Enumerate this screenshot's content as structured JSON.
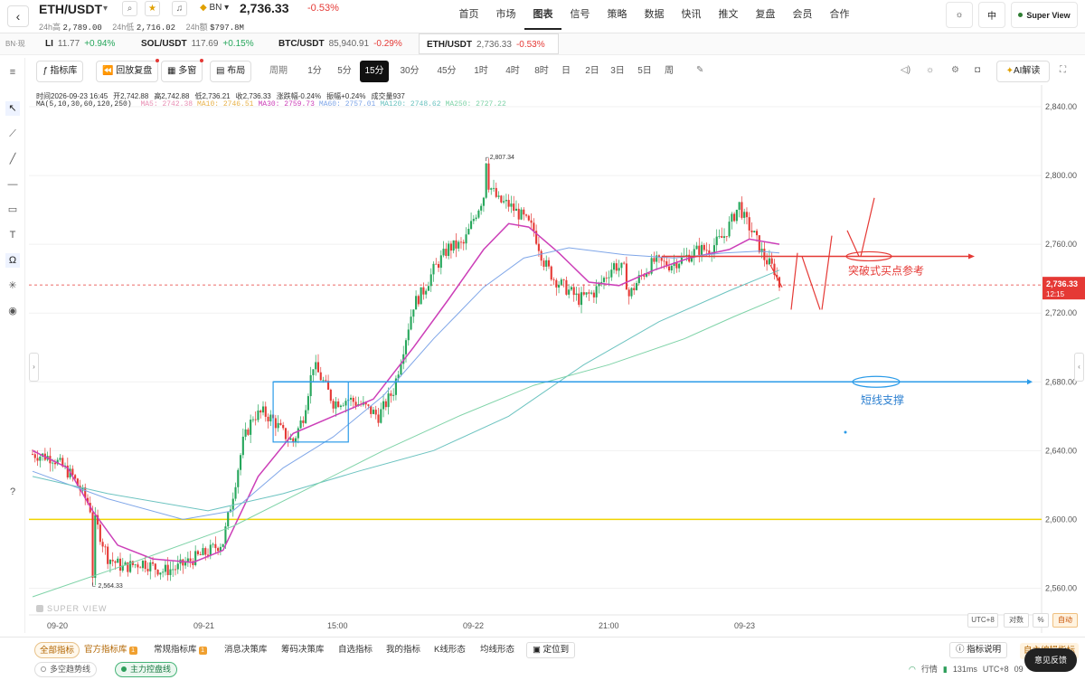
{
  "header": {
    "symbol": "ETH/USDT",
    "exchange": "BN",
    "price": "2,736.33",
    "change_pct": "-0.53%",
    "stats": [
      {
        "label": "24h高",
        "value": "2,789.00"
      },
      {
        "label": "24h低",
        "value": "2,716.02"
      },
      {
        "label": "24h额",
        "value": "$797.8M"
      }
    ],
    "nav": [
      "首页",
      "市场",
      "图表",
      "信号",
      "策略",
      "数据",
      "快讯",
      "推文",
      "复盘",
      "会员",
      "合作"
    ],
    "nav_active": "图表",
    "lang": "中",
    "super_view": "Super View"
  },
  "tickers": {
    "exchange_label": "BN·现",
    "items": [
      {
        "name": "LI",
        "price": "11.77",
        "change": "+0.94%",
        "dir": "up"
      },
      {
        "name": "SOL/USDT",
        "price": "117.69",
        "change": "+0.15%",
        "dir": "up"
      },
      {
        "name": "BTC/USDT",
        "price": "85,940.91",
        "change": "-0.29%",
        "dir": "down"
      },
      {
        "name": "ETH/USDT",
        "price": "2,736.33",
        "change": "-0.53%",
        "dir": "down"
      }
    ]
  },
  "toolbar": {
    "indicator_lib": "指标库",
    "replay": "回放复盘",
    "multi_window": "多窗",
    "layout": "布局",
    "period_label": "周期",
    "periods": [
      "1分",
      "5分",
      "15分",
      "30分",
      "45分",
      "1时",
      "4时",
      "8时",
      "日",
      "2日",
      "3日",
      "5日",
      "周"
    ],
    "period_active": "15分",
    "ai_label": "AI解读"
  },
  "ohlc_info": {
    "time": "时间2026-09-23 16:45",
    "open": "开2,742.88",
    "high": "高2,742.88",
    "low": "低2,736.21",
    "close": "收2,736.33",
    "change": "涨跌幅-0.24%",
    "amplitude": "振幅+0.24%",
    "volume": "成交量937"
  },
  "ma_info": {
    "label": "MA(5,10,30,60,120,250)",
    "items": [
      {
        "text": "MA5: 2742.38",
        "color": "#e88fb4"
      },
      {
        "text": "MA10: 2746.51",
        "color": "#e8b24a"
      },
      {
        "text": "MA30: 2759.73",
        "color": "#cc3fb8"
      },
      {
        "text": "MA60: 2757.01",
        "color": "#7fa6e8"
      },
      {
        "text": "MA120: 2748.62",
        "color": "#6cc3c0"
      },
      {
        "text": "MA250: 2727.22",
        "color": "#7fd3a8"
      }
    ]
  },
  "chart_data": {
    "type": "candlestick",
    "title": "",
    "ylim": [
      2545,
      2850
    ],
    "y_ticks": [
      2560,
      2600,
      2640,
      2680,
      2720,
      2760,
      2800,
      2840
    ],
    "y_tick_labels": [
      "2,560.00",
      "2,600.00",
      "2,640.00",
      "2,680.00",
      "2,720.00",
      "2,760.00",
      "2,800.00",
      "2,840.00"
    ],
    "x_labels": [
      "09-20",
      "09-21",
      "15:00",
      "09-22",
      "21:00",
      "09-23"
    ],
    "current_price": "2,736.33",
    "current_price_value": 2736.33,
    "countdown": "12:15",
    "high_marker": {
      "label": "2,807.34",
      "value": 2807.34
    },
    "low_marker": {
      "label": "2,564.33",
      "value": 2564.33
    },
    "close_path": [
      [
        0,
        2638
      ],
      [
        8,
        2636
      ],
      [
        16,
        2625
      ],
      [
        22,
        2610
      ],
      [
        26,
        2595
      ],
      [
        30,
        2578
      ],
      [
        36,
        2572
      ],
      [
        44,
        2575
      ],
      [
        52,
        2570
      ],
      [
        58,
        2572
      ],
      [
        64,
        2577
      ],
      [
        70,
        2581
      ],
      [
        76,
        2587
      ],
      [
        80,
        2615
      ],
      [
        84,
        2645
      ],
      [
        88,
        2660
      ],
      [
        92,
        2662
      ],
      [
        96,
        2658
      ],
      [
        100,
        2650
      ],
      [
        104,
        2645
      ],
      [
        108,
        2660
      ],
      [
        112,
        2690
      ],
      [
        116,
        2680
      ],
      [
        120,
        2668
      ],
      [
        126,
        2670
      ],
      [
        132,
        2666
      ],
      [
        138,
        2660
      ],
      [
        144,
        2675
      ],
      [
        148,
        2700
      ],
      [
        152,
        2725
      ],
      [
        156,
        2733
      ],
      [
        160,
        2745
      ],
      [
        166,
        2758
      ],
      [
        172,
        2760
      ],
      [
        176,
        2775
      ],
      [
        182,
        2795
      ],
      [
        186,
        2785
      ],
      [
        190,
        2783
      ],
      [
        196,
        2775
      ],
      [
        200,
        2768
      ],
      [
        204,
        2750
      ],
      [
        208,
        2740
      ],
      [
        214,
        2733
      ],
      [
        218,
        2728
      ],
      [
        224,
        2732
      ],
      [
        228,
        2740
      ],
      [
        232,
        2748
      ],
      [
        236,
        2745
      ],
      [
        238,
        2730
      ],
      [
        242,
        2740
      ],
      [
        248,
        2750
      ],
      [
        254,
        2748
      ],
      [
        260,
        2752
      ],
      [
        266,
        2757
      ],
      [
        270,
        2757
      ],
      [
        276,
        2765
      ],
      [
        282,
        2783
      ],
      [
        284,
        2775
      ],
      [
        288,
        2765
      ],
      [
        292,
        2752
      ],
      [
        296,
        2745
      ],
      [
        298,
        2736
      ]
    ],
    "total_bars": 298,
    "ma_lines": [
      {
        "name": "MA30",
        "color": "#cc3fb8",
        "points": [
          [
            0,
            2640
          ],
          [
            14,
            2630
          ],
          [
            24,
            2605
          ],
          [
            34,
            2585
          ],
          [
            48,
            2577
          ],
          [
            64,
            2575
          ],
          [
            76,
            2582
          ],
          [
            90,
            2625
          ],
          [
            104,
            2650
          ],
          [
            120,
            2660
          ],
          [
            136,
            2670
          ],
          [
            152,
            2700
          ],
          [
            166,
            2728
          ],
          [
            180,
            2757
          ],
          [
            190,
            2772
          ],
          [
            198,
            2770
          ],
          [
            210,
            2755
          ],
          [
            222,
            2738
          ],
          [
            234,
            2736
          ],
          [
            248,
            2745
          ],
          [
            262,
            2752
          ],
          [
            278,
            2757
          ],
          [
            286,
            2763
          ],
          [
            298,
            2760
          ]
        ]
      },
      {
        "name": "MA60",
        "color": "#7fa6e8",
        "points": [
          [
            0,
            2628
          ],
          [
            30,
            2612
          ],
          [
            60,
            2600
          ],
          [
            80,
            2605
          ],
          [
            100,
            2630
          ],
          [
            120,
            2648
          ],
          [
            140,
            2672
          ],
          [
            160,
            2705
          ],
          [
            180,
            2735
          ],
          [
            196,
            2752
          ],
          [
            214,
            2758
          ],
          [
            236,
            2754
          ],
          [
            256,
            2752
          ],
          [
            276,
            2755
          ],
          [
            290,
            2756
          ],
          [
            298,
            2755
          ]
        ]
      },
      {
        "name": "MA120",
        "color": "#6cc3c0",
        "points": [
          [
            0,
            2625
          ],
          [
            30,
            2615
          ],
          [
            70,
            2605
          ],
          [
            100,
            2615
          ],
          [
            130,
            2628
          ],
          [
            160,
            2640
          ],
          [
            190,
            2660
          ],
          [
            220,
            2690
          ],
          [
            250,
            2715
          ],
          [
            278,
            2733
          ],
          [
            298,
            2745
          ]
        ]
      },
      {
        "name": "MA250",
        "color": "#7fd3a8",
        "points": [
          [
            0,
            2555
          ],
          [
            40,
            2575
          ],
          [
            80,
            2596
          ],
          [
            110,
            2618
          ],
          [
            140,
            2640
          ],
          [
            170,
            2660
          ],
          [
            200,
            2678
          ],
          [
            230,
            2690
          ],
          [
            260,
            2705
          ],
          [
            280,
            2718
          ],
          [
            298,
            2729
          ]
        ]
      }
    ],
    "support_price": 2600,
    "annotations": {
      "breakout_level": 2753,
      "breakout_label": "突破式买点参考",
      "support_level": 2680,
      "support_label": "短线支撑",
      "box": {
        "bar_start": 96,
        "bar_end": 126,
        "price_low": 2645,
        "price_high": 2680
      }
    }
  },
  "axis_controls": {
    "tz": "UTC+8",
    "log": "对数",
    "pct": "%",
    "auto": "自动"
  },
  "watermark": "SUPER VIEW",
  "bottom": {
    "tabs": [
      {
        "label": "全部指标",
        "active": true
      },
      {
        "label": "官方指标库",
        "badge": "1",
        "orange": true
      },
      {
        "label": "常规指标库",
        "badge": "1"
      },
      {
        "label": "消息决策库"
      },
      {
        "label": "筹码决策库"
      },
      {
        "label": "自选指标"
      },
      {
        "label": "我的指标"
      },
      {
        "label": "K线形态"
      },
      {
        "label": "均线形态"
      }
    ],
    "locate": "定位到",
    "indicator_explain": "指标说明",
    "custom_edit": "自主编辑指标",
    "chips": [
      {
        "label": "多空趋势线",
        "active": false
      },
      {
        "label": "主力控盘线",
        "active": true
      }
    ],
    "status": {
      "label": "行情",
      "latency": "131ms",
      "tz": "UTC+8",
      "time": "09"
    },
    "feedback": "意见反馈"
  }
}
